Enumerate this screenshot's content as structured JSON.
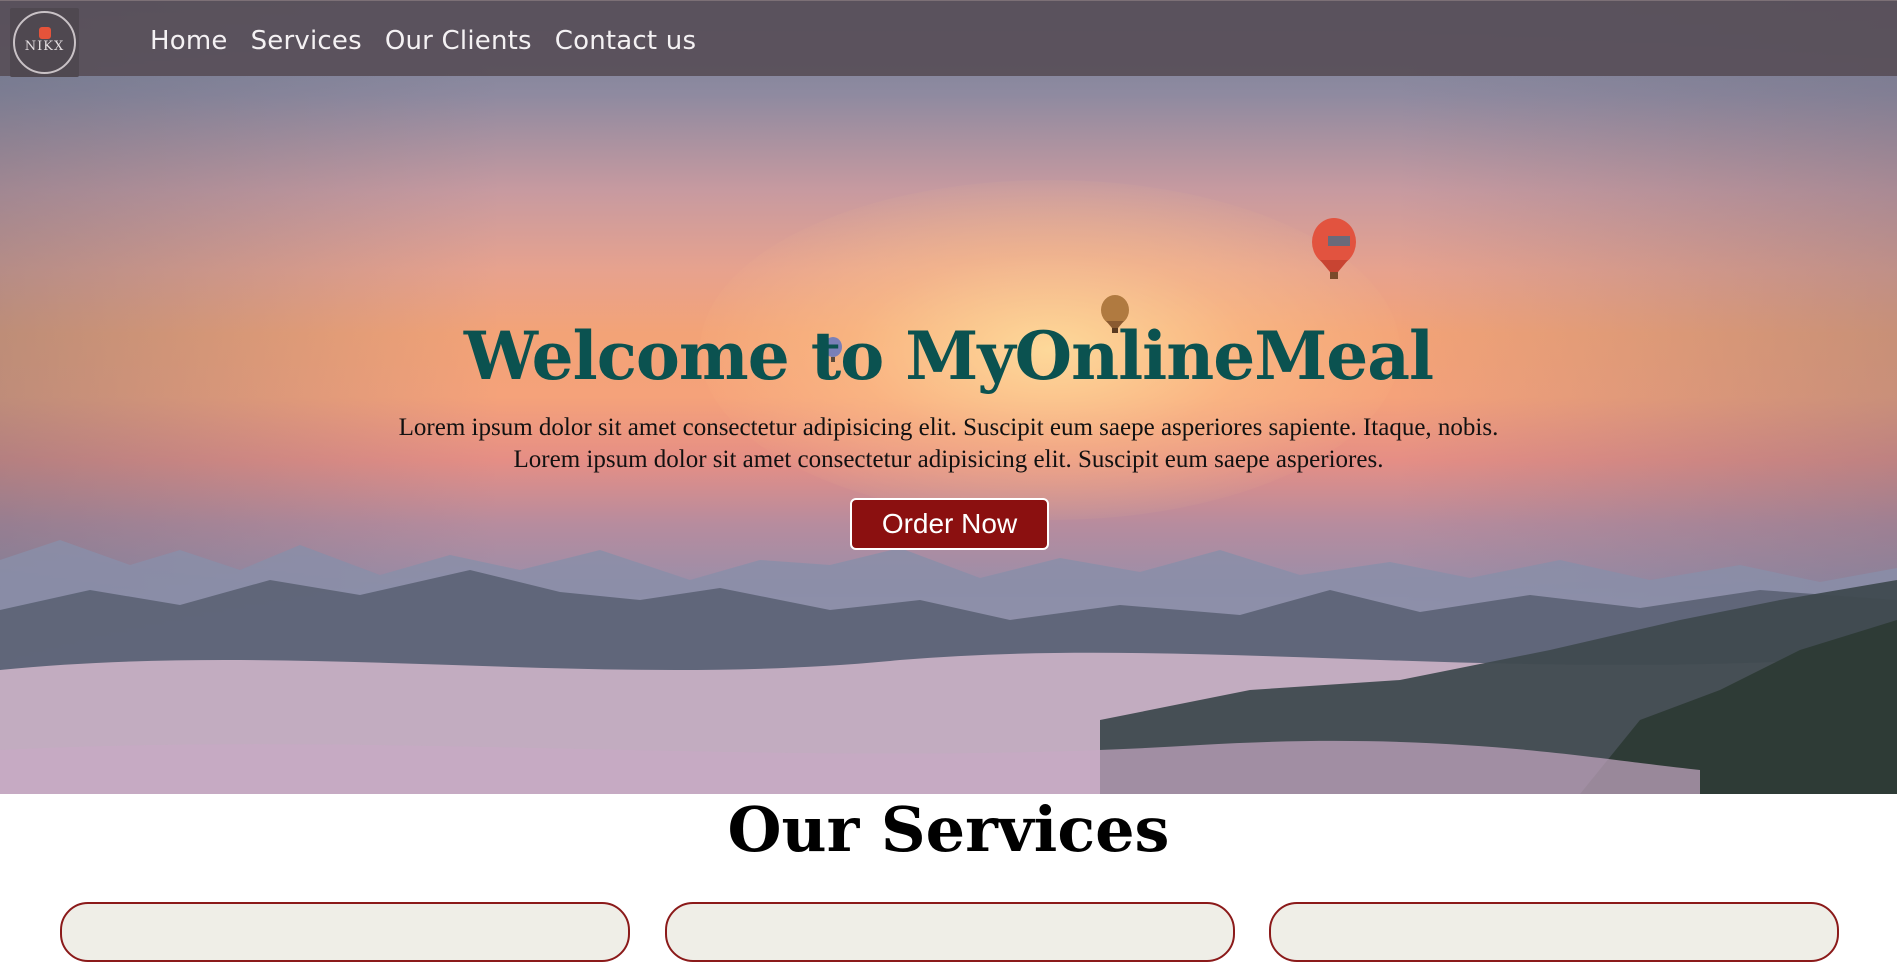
{
  "nav": {
    "logo_text": "NIKX",
    "links": [
      "Home",
      "Services",
      "Our Clients",
      "Contact us"
    ]
  },
  "hero": {
    "title": "Welcome to MyOnlineMeal",
    "line1": "Lorem ipsum dolor sit amet consectetur adipisicing elit. Suscipit eum saepe asperiores sapiente. Itaque, nobis.",
    "line2": "Lorem ipsum dolor sit amet consectetur adipisicing elit. Suscipit eum saepe asperiores.",
    "button_label": "Order Now"
  },
  "services": {
    "title": "Our Services"
  },
  "colors": {
    "nav_background": "#584e58",
    "title_teal": "#0b5250",
    "button_red": "#8b1010",
    "card_border": "#8b1a1a",
    "card_background": "#efeee7"
  }
}
